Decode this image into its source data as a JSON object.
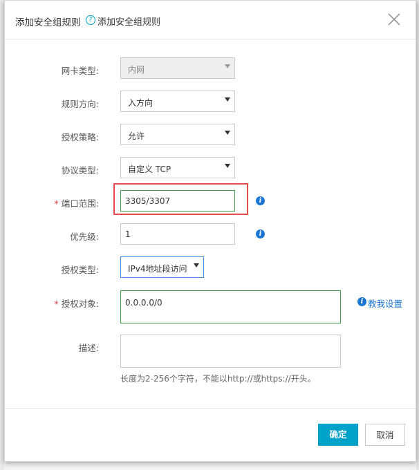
{
  "dialog": {
    "title": "添加安全组规则",
    "help_icon": "?",
    "help_text": "添加安全组规则",
    "close_icon": "close-icon"
  },
  "form": {
    "nic_type": {
      "label": "网卡类型:",
      "value": "内网",
      "disabled": true
    },
    "direction": {
      "label": "规则方向:",
      "value": "入方向"
    },
    "policy": {
      "label": "授权策略:",
      "value": "允许"
    },
    "protocol": {
      "label": "协议类型:",
      "value": "自定义 TCP"
    },
    "port_range": {
      "required_mark": "*",
      "label": "端口范围:",
      "value": "3305/3307"
    },
    "priority": {
      "label": "优先级:",
      "value": "1"
    },
    "auth_type": {
      "label": "授权类型:",
      "value": "IPv4地址段访问"
    },
    "auth_object": {
      "required_mark": "*",
      "label": "授权对象:",
      "value": "0.0.0.0/0",
      "teach_link": "教我设置"
    },
    "description": {
      "label": "描述:",
      "value": "",
      "hint": "长度为2-256个字符，不能以http://或https://开头。"
    },
    "info_icon": "i"
  },
  "footer": {
    "ok_label": "确定",
    "cancel_label": "取消"
  },
  "colors": {
    "accent": "#00a2ca",
    "link": "#1b76d1",
    "required": "#e4393c",
    "highlight": "#e84c4c",
    "valid_border": "#3ea04a"
  }
}
